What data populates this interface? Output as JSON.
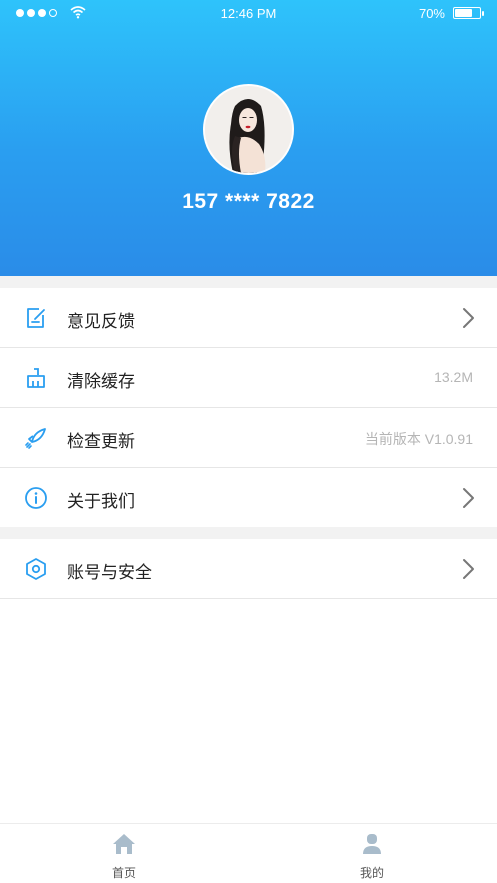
{
  "status_bar": {
    "time": "12:46 PM",
    "battery": "70%",
    "battery_level": 0.7
  },
  "profile": {
    "phone": "157 **** 7822",
    "avatar_icon": "user-avatar-photo"
  },
  "menu": [
    {
      "label": "意见反馈",
      "icon": "feedback-icon",
      "value": "",
      "chevron": true
    },
    {
      "label": "清除缓存",
      "icon": "broom-icon",
      "value": "13.2M",
      "chevron": false
    },
    {
      "label": "检查更新",
      "icon": "rocket-icon",
      "value": "当前版本 V1.0.91",
      "chevron": false
    },
    {
      "label": "关于我们",
      "icon": "info-icon",
      "value": "",
      "chevron": true
    }
  ],
  "account": {
    "label": "账号与安全",
    "icon": "hexagon-shield-icon",
    "chevron": true
  },
  "tabbar": {
    "home_label": "首页",
    "mine_label": "我的"
  },
  "colors": {
    "header_top": "#2ec3fb",
    "header_bottom": "#2a8ce8",
    "icon_blue": "#2a9ef0",
    "tab_icon": "#a9bccb"
  }
}
